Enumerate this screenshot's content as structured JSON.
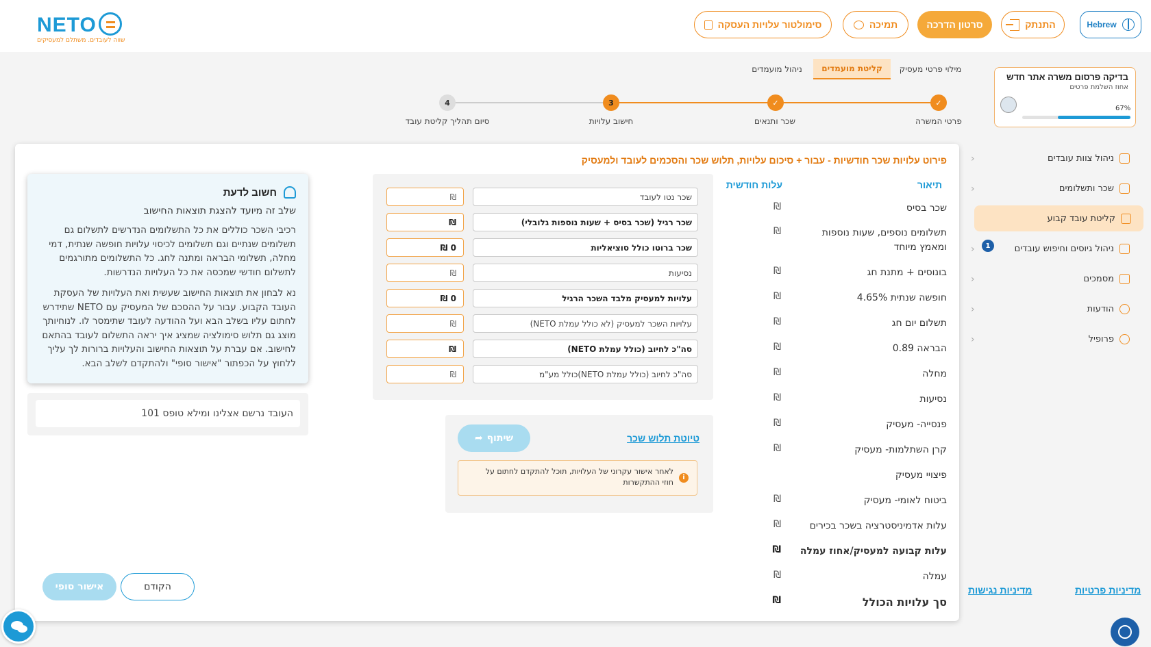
{
  "header": {
    "logo_text": "NETO",
    "logo_tagline": "שווה לעובדים. משתלם למעסיקים",
    "simulator_label": "סימולטור עלויות העסקה",
    "support_label": "תמיכה",
    "tutorial_label": "סרטון הדרכה",
    "logout_label": "התנתק",
    "language_label": "Hebrew"
  },
  "sidebar": {
    "progress_card": {
      "title": "בדיקה פרסום משרה אתר חדש",
      "subtitle": "אחוז השלמת פרטים",
      "percent_text": "67%",
      "percent": 67
    },
    "items": [
      {
        "label": "ניהול צוות עובדים"
      },
      {
        "label": "שכר ותשלומים"
      },
      {
        "label": "קליטת עובד קבוע"
      },
      {
        "label": "ניהול גיוסים וחיפוש עובדים",
        "badge": "1"
      },
      {
        "label": "מסמכים"
      },
      {
        "label": "הודעות"
      },
      {
        "label": "פרופיל"
      }
    ],
    "privacy_policy": "מדיניות פרטיות",
    "accessibility_policy": "מדיניות נגישות"
  },
  "tabs": [
    "מילוי פרטי מעסיק",
    "קליטת מועמדים",
    "ניהול מועמדים"
  ],
  "stepper": {
    "steps": [
      {
        "number": "✓",
        "label": "פרטי המשרה"
      },
      {
        "number": "✓",
        "label": "שכר ותנאים"
      },
      {
        "number": "3",
        "label": "חישוב עלויות"
      },
      {
        "number": "4",
        "label": "סיום תהליך קליטת עובד"
      }
    ]
  },
  "panel": {
    "title": "פירוט עלויות שכר חודשיות - עבור + סיכום עלויות, תלוש שכר והסכמים לעובד ולמעסיק",
    "col_description": "תיאור",
    "col_monthly": "עלות חודשית",
    "cost_rows": [
      {
        "label": "שכר בסיס",
        "value": "₪"
      },
      {
        "label": "תשלומים נוספים, שעות נוספות ומאמץ מיוחד",
        "value": "₪"
      },
      {
        "label": "בונוסים + מתנת חג",
        "value": "₪"
      },
      {
        "label": "חופשה שנתית 4.65%",
        "value": "₪"
      },
      {
        "label": "תשלום יום חג",
        "value": "₪"
      },
      {
        "label": "הבראה 0.89",
        "value": "₪"
      },
      {
        "label": "מחלה",
        "value": "₪"
      },
      {
        "label": "נסיעות",
        "value": "₪"
      },
      {
        "label": "פנסייה- מעסיק",
        "value": "₪"
      },
      {
        "label": "קרן השתלמות- מעסיק",
        "value": "₪"
      },
      {
        "label": "פיצויי מעסיק",
        "value": ""
      },
      {
        "label": "ביטוח לאומי- מעסיק",
        "value": "₪"
      },
      {
        "label": "עלות אדמיניסטרציה בשכר בכירים",
        "value": "₪"
      },
      {
        "label": "עלות קבועה למעסיק/אחוז עמלה",
        "value": "₪"
      },
      {
        "label": "עמלה",
        "value": "₪"
      },
      {
        "label": "סך עלויות הכולל",
        "value": "₪"
      }
    ],
    "summary_rows": [
      {
        "label": "שכר נטו לעובד",
        "amount": "₪"
      },
      {
        "label": "שכר רגיל (שכר בסיס + שעות נוספות גלובלי)",
        "amount": "₪"
      },
      {
        "label": "שכר ברוטו כולל סוציאליות",
        "amount": "0 ₪"
      },
      {
        "label": "נסיעות",
        "amount": "₪"
      },
      {
        "label": "עלויות למעסיק מלבד השכר הרגיל",
        "amount": "0 ₪"
      },
      {
        "label": "עלויות השכר למעסיק (לא כולל עמלת NETO)",
        "amount": "₪"
      },
      {
        "label": "סה\"כ לחיוב (כולל עמלת NETO)",
        "amount": "₪"
      },
      {
        "label": "סה\"כ לחיוב (כולל עמלת NETO)כולל מע\"מ",
        "amount": "₪"
      }
    ],
    "draft_payslip_link": "טיוטת תלוש שכר",
    "share_label": "שיתוף",
    "notice_text": "לאחר אישור עקרוני של העלויות, תוכל להתקדם לחתום על חוזי ההתקשרות",
    "info": {
      "title": "חשוב לדעת",
      "subtitle": "שלב זה מיועד להצגת תוצאות החישוב",
      "paragraph1": "רכיבי השכר כוללים את כל התשלומים הנדרשים לתשלום גם תשלומים שנתיים וגם תשלומים לכיסוי עלויות חופשה שנתית, דמי מחלה, תשלומי הבראה ומתנה לחג. כל התשלומים מתורגמים לתשלום חודשי שמכסה את כל העלויות הנדרשות.",
      "paragraph2": "נא לבחון את תוצאות החישוב שעשית ואת העלויות של העסקת העובד הקבוע. עבור על ההסכם של המעסיק עם NETO שתידרש לחתום עליו בשלב הבא ועל ההודעה לעובד שתימסר לו. לנוחיותך מוצג גם תלוש סימולציה שמציג איך יראה התשלום לעובד בהתאם לחישוב. אם עברת על תוצאות החישוב והעלויות ברורות לך עליך ללחוץ על הכפתור \"אישור סופי\" ולהתקדם לשלב הבא."
    },
    "form_101_note": "העובד נרשם אצלינו ומילא טופס 101",
    "prev_button": "הקודם",
    "final_button": "אישור סופי"
  }
}
